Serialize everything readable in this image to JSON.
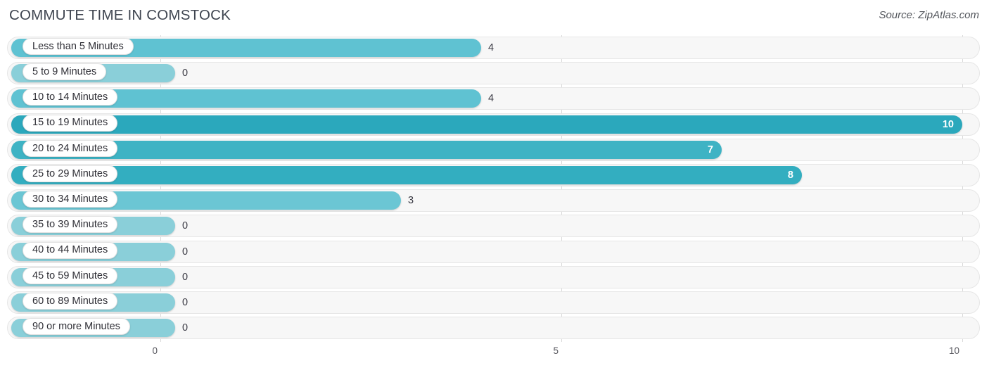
{
  "header": {
    "title": "COMMUTE TIME IN COMSTOCK",
    "source": "Source: ZipAtlas.com"
  },
  "colors": {
    "bar_max": "#2BA8BC",
    "bar_high": "#33AEC0",
    "bar_mid": "#46B6C6",
    "bar_low": "#5FC2D2",
    "bar_zero": "#8ACFD9",
    "track_fill": "#F7F7F7",
    "track_border": "#E6E6E6",
    "gridline": "#D9D9D9",
    "title_text": "#3F4550",
    "value_text": "#3A3A44"
  },
  "chart_data": {
    "type": "bar",
    "orientation": "horizontal",
    "title": "COMMUTE TIME IN COMSTOCK",
    "xlabel": "",
    "ylabel": "",
    "xlim": [
      0,
      10
    ],
    "grid": true,
    "legend": "none",
    "xticks": [
      "0",
      "5",
      "10"
    ],
    "xtick_values": [
      0,
      5,
      10
    ],
    "categories": [
      "Less than 5 Minutes",
      "5 to 9 Minutes",
      "10 to 14 Minutes",
      "15 to 19 Minutes",
      "20 to 24 Minutes",
      "25 to 29 Minutes",
      "30 to 34 Minutes",
      "35 to 39 Minutes",
      "40 to 44 Minutes",
      "45 to 59 Minutes",
      "60 to 89 Minutes",
      "90 or more Minutes"
    ],
    "values": [
      4,
      0,
      4,
      10,
      7,
      8,
      3,
      0,
      0,
      0,
      0,
      0
    ],
    "value_labels": [
      "4",
      "0",
      "4",
      "10",
      "7",
      "8",
      "3",
      "0",
      "0",
      "0",
      "0",
      "0"
    ]
  },
  "rows": [
    {
      "label": "Less than 5 Minutes",
      "value": 4,
      "value_label": "4",
      "color": "#5FC2D2",
      "inside": false
    },
    {
      "label": "5 to 9 Minutes",
      "value": 0,
      "value_label": "0",
      "color": "#8ACFD9",
      "inside": false
    },
    {
      "label": "10 to 14 Minutes",
      "value": 4,
      "value_label": "4",
      "color": "#5FC2D2",
      "inside": false
    },
    {
      "label": "15 to 19 Minutes",
      "value": 10,
      "value_label": "10",
      "color": "#2BA8BC",
      "inside": true
    },
    {
      "label": "20 to 24 Minutes",
      "value": 7,
      "value_label": "7",
      "color": "#3EB3C4",
      "inside": true
    },
    {
      "label": "25 to 29 Minutes",
      "value": 8,
      "value_label": "8",
      "color": "#33AEC0",
      "inside": true
    },
    {
      "label": "30 to 34 Minutes",
      "value": 3,
      "value_label": "3",
      "color": "#6BC6D4",
      "inside": false
    },
    {
      "label": "35 to 39 Minutes",
      "value": 0,
      "value_label": "0",
      "color": "#8ACFD9",
      "inside": false
    },
    {
      "label": "40 to 44 Minutes",
      "value": 0,
      "value_label": "0",
      "color": "#8ACFD9",
      "inside": false
    },
    {
      "label": "45 to 59 Minutes",
      "value": 0,
      "value_label": "0",
      "color": "#8ACFD9",
      "inside": false
    },
    {
      "label": "60 to 89 Minutes",
      "value": 0,
      "value_label": "0",
      "color": "#8ACFD9",
      "inside": false
    },
    {
      "label": "90 or more Minutes",
      "value": 0,
      "value_label": "0",
      "color": "#8ACFD9",
      "inside": false
    }
  ],
  "axis": {
    "ticks": [
      {
        "label": "0",
        "value": 0
      },
      {
        "label": "5",
        "value": 5
      },
      {
        "label": "10",
        "value": 10
      }
    ]
  }
}
